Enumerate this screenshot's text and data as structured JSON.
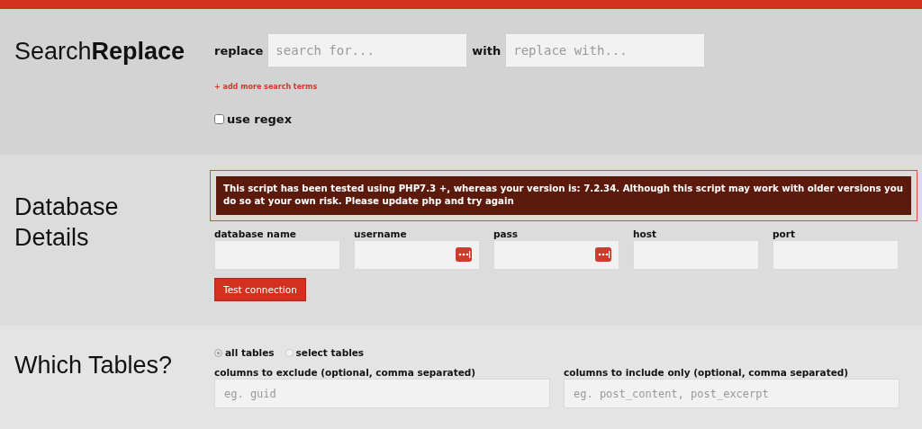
{
  "search_replace": {
    "title": "Search**Replace**",
    "replace_label": "replace",
    "search_placeholder": "search for...",
    "with_label": "with",
    "replace_placeholder": "replace with...",
    "add_terms_link": "+ add more search terms",
    "regex": {
      "label": "use regex",
      "checked": false
    }
  },
  "database": {
    "title": "Database Details",
    "warning": "This script has been tested using PHP7.3 +, whereas your version is: 7.2.34. Although this script may work with older versions you do so at your own risk. Please update php and try again",
    "fields": [
      {
        "label": "database name",
        "password_icon": false
      },
      {
        "label": "username",
        "password_icon": true
      },
      {
        "label": "pass",
        "password_icon": true
      },
      {
        "label": "host",
        "password_icon": false
      },
      {
        "label": "port",
        "password_icon": false
      }
    ],
    "test_button": "Test connection"
  },
  "tables": {
    "title": "Which Tables?",
    "options": [
      {
        "label": "all tables",
        "selected": true
      },
      {
        "label": "select tables",
        "selected": false
      }
    ],
    "columns": [
      {
        "label": "columns to exclude (optional, comma separated)",
        "placeholder": "eg. guid"
      },
      {
        "label": "columns to include only (optional, comma separated)",
        "placeholder": "eg. post_content, post_excerpt"
      }
    ]
  }
}
